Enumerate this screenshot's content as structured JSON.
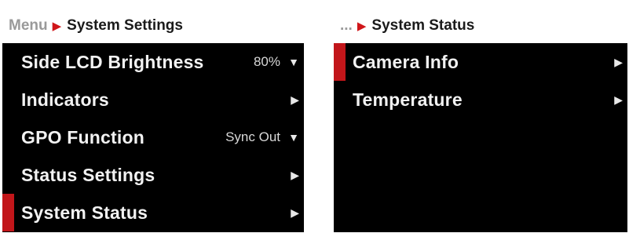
{
  "left": {
    "header": {
      "root": "Menu",
      "current": "System Settings"
    },
    "items": [
      {
        "label": "Side LCD Brightness",
        "value": "80%",
        "control": "dropdown"
      },
      {
        "label": "Indicators",
        "value": "",
        "control": "submenu"
      },
      {
        "label": "GPO Function",
        "value": "Sync Out",
        "control": "dropdown"
      },
      {
        "label": "Status Settings",
        "value": "",
        "control": "submenu"
      },
      {
        "label": "System Status",
        "value": "",
        "control": "submenu",
        "selected": true
      }
    ]
  },
  "right": {
    "header": {
      "root": "...",
      "current": "System Status"
    },
    "items": [
      {
        "label": "Camera Info",
        "control": "submenu",
        "selected": true
      },
      {
        "label": "Temperature",
        "control": "submenu"
      }
    ]
  },
  "icons": {
    "breadcrumb": "triangle-right",
    "dropdown": "chevron-down",
    "submenu": "chevron-right"
  },
  "colors": {
    "accent": "#c2161a",
    "background": "#000000",
    "header_bg": "#ffffff",
    "text": "#f2f2f2"
  }
}
